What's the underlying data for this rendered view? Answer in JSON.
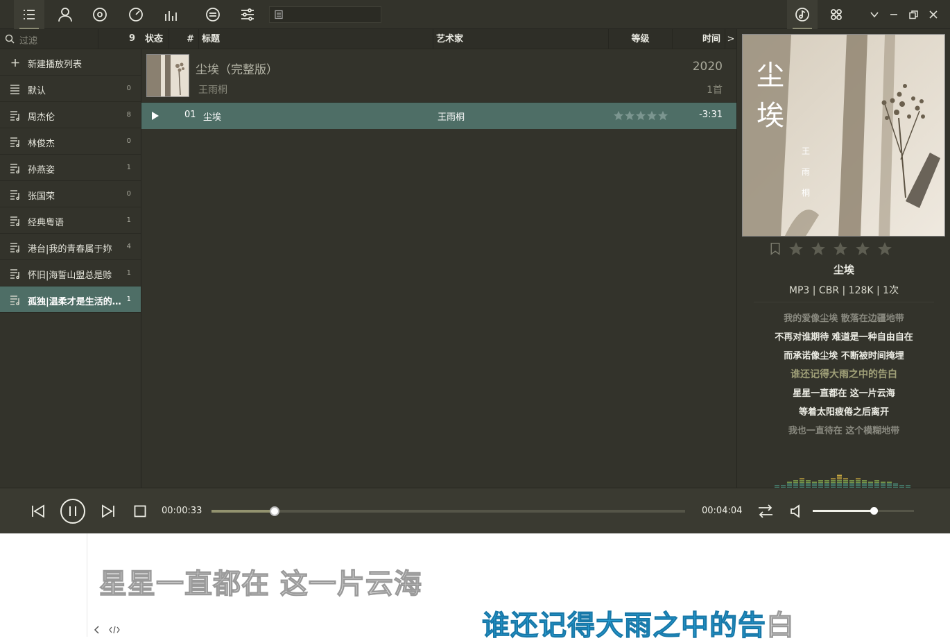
{
  "toolbar": {
    "search_placeholder": ""
  },
  "sidebar": {
    "filter_placeholder": "过滤",
    "playlist_count": "9",
    "new_playlist_label": "新建播放列表",
    "items": [
      {
        "label": "默认",
        "count": "0"
      },
      {
        "label": "周杰伦",
        "count": "8"
      },
      {
        "label": "林俊杰",
        "count": "0"
      },
      {
        "label": "孙燕姿",
        "count": "1"
      },
      {
        "label": "张国荣",
        "count": "0"
      },
      {
        "label": "经典粤语",
        "count": "1"
      },
      {
        "label": "港台|我的青春属于妳",
        "count": "4"
      },
      {
        "label": "怀旧|海誓山盟总是赊",
        "count": "1"
      },
      {
        "label": "孤独|温柔才是生活的...",
        "count": "1"
      }
    ]
  },
  "columns": {
    "status": "状态",
    "number": "#",
    "title": "标题",
    "artist": "艺术家",
    "rating": "等级",
    "time": "时间",
    "more": ">"
  },
  "album": {
    "title": "尘埃（完整版）",
    "artist": "王雨桐",
    "year": "2020",
    "count": "1首"
  },
  "track": {
    "number": "01",
    "title": "尘埃",
    "artist": "王雨桐",
    "rating": 0,
    "time": "-3:31"
  },
  "now_playing": {
    "cover_title": "尘埃",
    "cover_artist": "王雨桐",
    "song_name": "尘埃",
    "format_info": "MP3 | CBR | 128K | 1次",
    "rating": 0
  },
  "lyrics": [
    {
      "text": "我的爱像尘埃 散落在边疆地带",
      "state": "past"
    },
    {
      "text": "不再对谁期待 难道是一种自由自在",
      "state": "normal"
    },
    {
      "text": "而承诺像尘埃 不断被时间掩埋",
      "state": "normal"
    },
    {
      "text": "谁还记得大雨之中的告白",
      "state": "current"
    },
    {
      "text": "星星一直都在 这一片云海",
      "state": "normal"
    },
    {
      "text": "等着太阳疲倦之后离开",
      "state": "normal"
    },
    {
      "text": "我也一直待在 这个模糊地带",
      "state": "past"
    }
  ],
  "player": {
    "current_time": "00:00:33",
    "total_time": "00:04:04",
    "progress": 0.133,
    "volume": 0.6
  },
  "desktop_lyrics": {
    "line1": "星星一直都在 这一片云海",
    "line2_sung": "谁还记得大雨之中的告",
    "line2_rest": "白"
  },
  "colors": {
    "background": "#33332b",
    "selection": "#4e6e66",
    "lyric_current": "#a0a078",
    "desktop_lyric_highlight": "#2aa2d8"
  }
}
